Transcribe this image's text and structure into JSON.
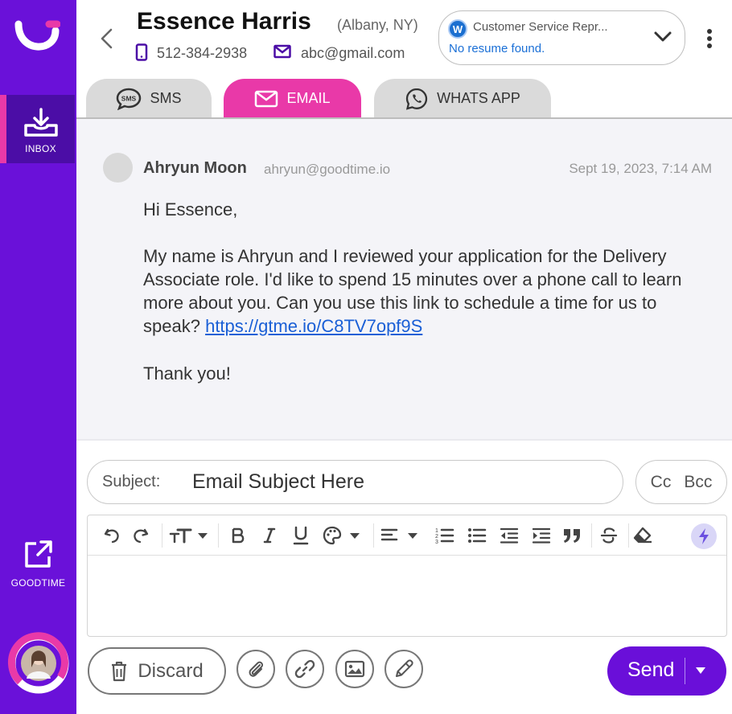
{
  "sidebar": {
    "inbox_label": "INBOX",
    "goodtime_label": "GOODTIME",
    "accent_color": "#e939a8",
    "bg_color": "#6a11d9"
  },
  "contact": {
    "name": "Essence Harris",
    "location": "(Albany, NY)",
    "phone": "512-384-2938",
    "email": "abc@gmail.com"
  },
  "job": {
    "logo_letter": "W",
    "title": "Customer Service Repr...",
    "resume_status": "No resume found."
  },
  "tabs": [
    {
      "label": "SMS",
      "icon": "sms-bubble-icon",
      "active": false
    },
    {
      "label": "EMAIL",
      "icon": "envelope-icon",
      "active": true
    },
    {
      "label": "WHATS APP",
      "icon": "whatsapp-icon",
      "active": false
    }
  ],
  "message": {
    "sender_name": "Ahryun Moon",
    "sender_email": "ahryun@goodtime.io",
    "date": "Sept 19, 2023, 7:14 AM",
    "greeting": "Hi Essence,",
    "body": "My name is Ahryun and I reviewed your application for the Delivery Associate role. I'd like to spend 15 minutes over a phone call to learn more about you. Can you use this link to schedule a time for us to speak?",
    "link": "https://gtme.io/C8TV7opf9S",
    "closing": "Thank you!"
  },
  "composer": {
    "subject_label": "Subject:",
    "subject_value": "Email Subject Here",
    "cc_label": "Cc",
    "bcc_label": "Bcc",
    "toolbar_icons": [
      "undo-icon",
      "redo-icon",
      "font-size-icon",
      "bold-icon",
      "italic-icon",
      "underline-icon",
      "palette-icon",
      "align-icon",
      "ordered-list-icon",
      "bullet-list-icon",
      "outdent-icon",
      "indent-icon",
      "quote-icon",
      "strikethrough-icon",
      "clear-format-icon",
      "lightning-icon"
    ],
    "body_value": "",
    "discard_label": "Discard",
    "send_label": "Send",
    "send_color": "#6a0fd9"
  }
}
